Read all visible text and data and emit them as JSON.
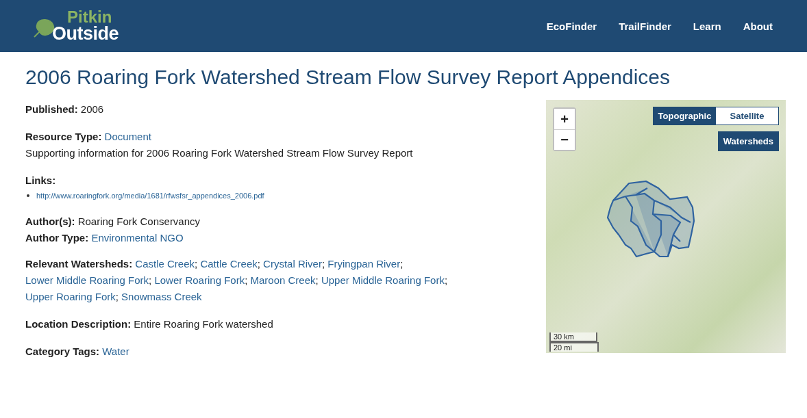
{
  "header": {
    "logo": {
      "top": "Pitkin",
      "bottom": "Outside"
    },
    "nav": [
      {
        "label": "EcoFinder"
      },
      {
        "label": "TrailFinder"
      },
      {
        "label": "Learn"
      },
      {
        "label": "About"
      }
    ]
  },
  "title": "2006 Roaring Fork Watershed Stream Flow Survey Report Appendices",
  "published": {
    "label": "Published:",
    "value": "2006"
  },
  "resource_type": {
    "label": "Resource Type:",
    "value": "Document"
  },
  "description": "Supporting information for 2006 Roaring Fork Watershed Stream Flow Survey Report",
  "links": {
    "label": "Links:",
    "items": [
      "http://www.roaringfork.org/media/1681/rfwsfsr_appendices_2006.pdf"
    ]
  },
  "authors": {
    "label": "Author(s):",
    "value": "Roaring Fork Conservancy"
  },
  "author_type": {
    "label": "Author Type:",
    "value": "Environmental NGO"
  },
  "watersheds": {
    "label": "Relevant Watersheds:",
    "separator": ";",
    "items": [
      "Castle Creek",
      "Cattle Creek",
      "Crystal River",
      "Fryingpan River",
      "Lower Middle Roaring Fork",
      "Lower Roaring Fork",
      "Maroon Creek",
      "Upper Middle Roaring Fork",
      "Upper Roaring Fork",
      "Snowmass Creek"
    ]
  },
  "location": {
    "label": "Location Description:",
    "value": "Entire Roaring Fork watershed"
  },
  "category": {
    "label": "Category Tags:",
    "value": "Water"
  },
  "map": {
    "zoom_in": "+",
    "zoom_out": "−",
    "base_layers": [
      {
        "label": "Topographic",
        "selected": true
      },
      {
        "label": "Satellite",
        "selected": false
      }
    ],
    "overlay": {
      "label": "Watersheds",
      "on": true
    },
    "scale": {
      "metric": "30 km",
      "imperial": "20 mi"
    }
  }
}
